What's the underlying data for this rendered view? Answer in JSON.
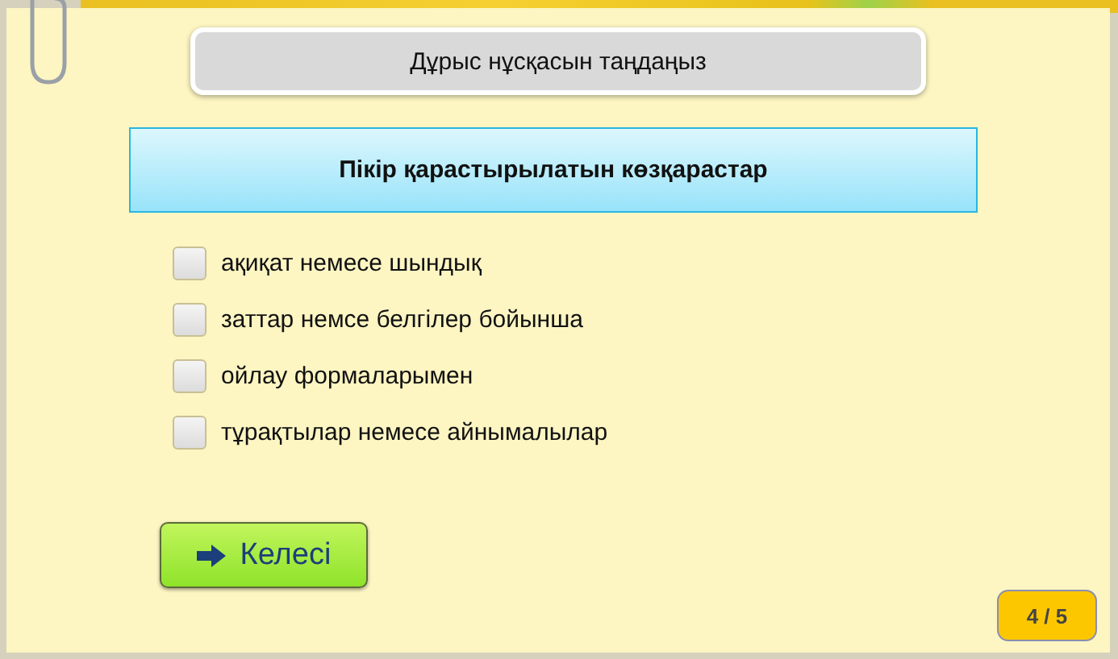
{
  "instruction": "Дұрыс нұсқасын таңдаңыз",
  "question": "Пікір қарастырылатын көзқарастар",
  "options": [
    {
      "label": "ақиқат немесе шындық",
      "checked": false
    },
    {
      "label": "заттар немсе белгілер бойынша",
      "checked": false
    },
    {
      "label": "ойлау формаларымен",
      "checked": false
    },
    {
      "label": "тұрақтылар немесе айнымалылар",
      "checked": false
    }
  ],
  "next_button": "Келесі",
  "counter": "4 / 5"
}
